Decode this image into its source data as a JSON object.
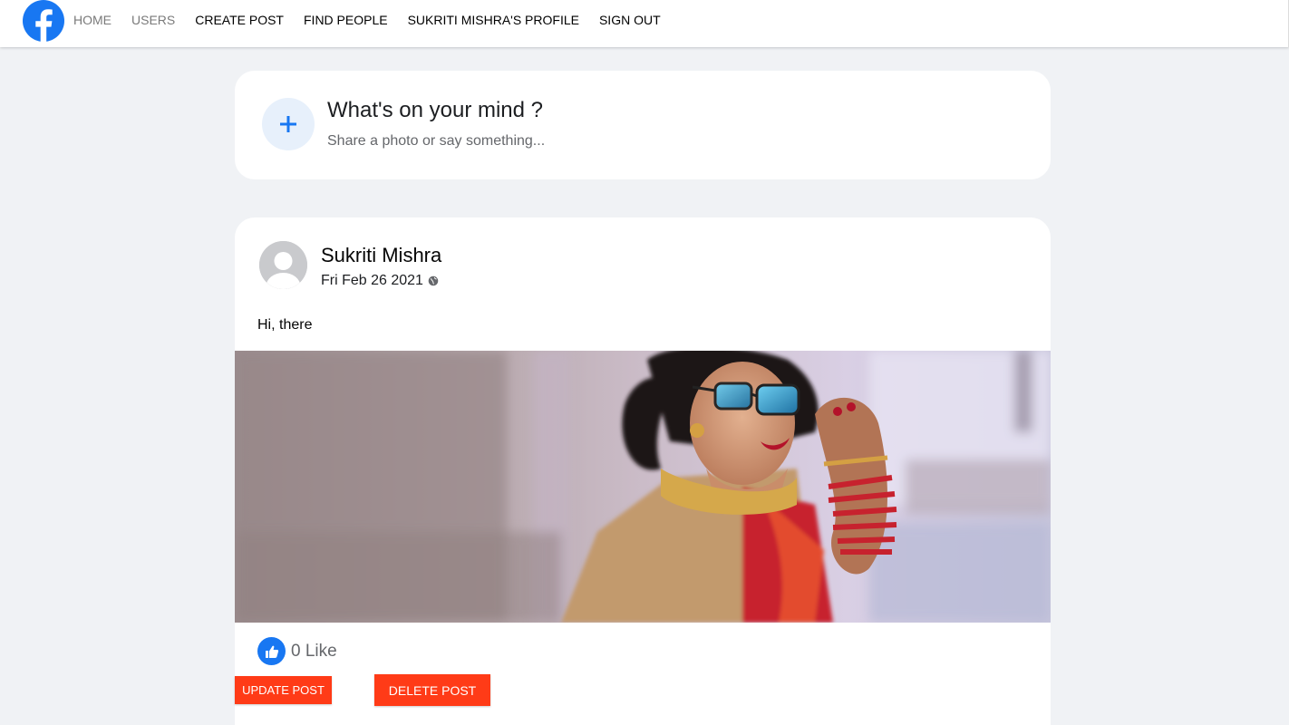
{
  "nav": {
    "logo_icon": "facebook-logo-icon",
    "items": [
      {
        "label": "HOME",
        "muted": true
      },
      {
        "label": "USERS",
        "muted": true
      },
      {
        "label": "CREATE POST",
        "muted": false
      },
      {
        "label": "FIND PEOPLE",
        "muted": false
      },
      {
        "label": "SUKRITI MISHRA'S PROFILE",
        "muted": false
      },
      {
        "label": "SIGN OUT",
        "muted": false
      }
    ]
  },
  "composer": {
    "icon": "plus-icon",
    "title": "What's on your mind ?",
    "subtitle": "Share a photo or say something..."
  },
  "post": {
    "author": "Sukriti Mishra",
    "date": "Fri Feb 26 2021",
    "privacy_icon": "globe-icon",
    "text": "Hi, there",
    "likes": {
      "icon": "thumbs-up-icon",
      "count_text": "0 Like"
    }
  },
  "actions": {
    "update_label": "UPDATE POST",
    "delete_label": "DELETE POST"
  },
  "colors": {
    "brand": "#1877f2",
    "danger": "#ff3b17",
    "background": "#f0f2f5"
  }
}
